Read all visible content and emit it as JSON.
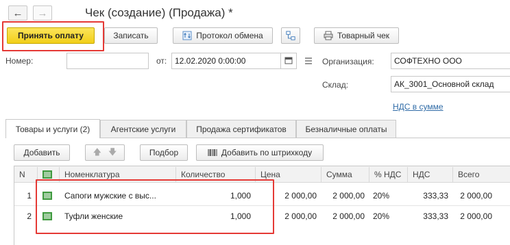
{
  "window": {
    "title": "Чек (создание) (Продажа) *",
    "back_icon": "arrow-left-icon",
    "forward_icon": "arrow-right-icon"
  },
  "toolbar": {
    "accept_payment": "Принять оплату",
    "save": "Записать",
    "exchange_log": "Протокол обмена",
    "structure_icon": "structure-icon",
    "sales_receipt": "Товарный чек"
  },
  "form": {
    "number_label": "Номер:",
    "number_value": "",
    "date_label": "от:",
    "date_value": "12.02.2020  0:00:00",
    "org_label": "Организация:",
    "org_value": "СОФТЕХНО ООО",
    "warehouse_label": "Склад:",
    "warehouse_value": "АК_3001_Основной склад",
    "vat_link": "НДС в сумме"
  },
  "tabs": [
    {
      "label": "Товары и услуги (2)",
      "active": true
    },
    {
      "label": "Агентские услуги",
      "active": false
    },
    {
      "label": "Продажа сертификатов",
      "active": false
    },
    {
      "label": "Безналичные оплаты",
      "active": false
    }
  ],
  "table_toolbar": {
    "add": "Добавить",
    "pick": "Подбор",
    "add_barcode": "Добавить по штрихкоду"
  },
  "table": {
    "headers": {
      "n": "N",
      "item": "Номенклатура",
      "qty": "Количество",
      "price": "Цена",
      "sum": "Сумма",
      "vat_rate": "% НДС",
      "vat": "НДС",
      "total": "Всего"
    },
    "rows": [
      {
        "n": "1",
        "item": "Сапоги мужские с выс...",
        "qty": "1,000",
        "price": "2 000,00",
        "sum": "2 000,00",
        "vat_rate": "20%",
        "vat": "333,33",
        "total": "2 000,00"
      },
      {
        "n": "2",
        "item": "Туфли женские",
        "qty": "1,000",
        "price": "2 000,00",
        "sum": "2 000,00",
        "vat_rate": "20%",
        "vat": "333,33",
        "total": "2 000,00"
      }
    ]
  },
  "colors": {
    "highlight": "#e53935",
    "primary_button": "#f2cf18",
    "link": "#2e6aa6"
  }
}
